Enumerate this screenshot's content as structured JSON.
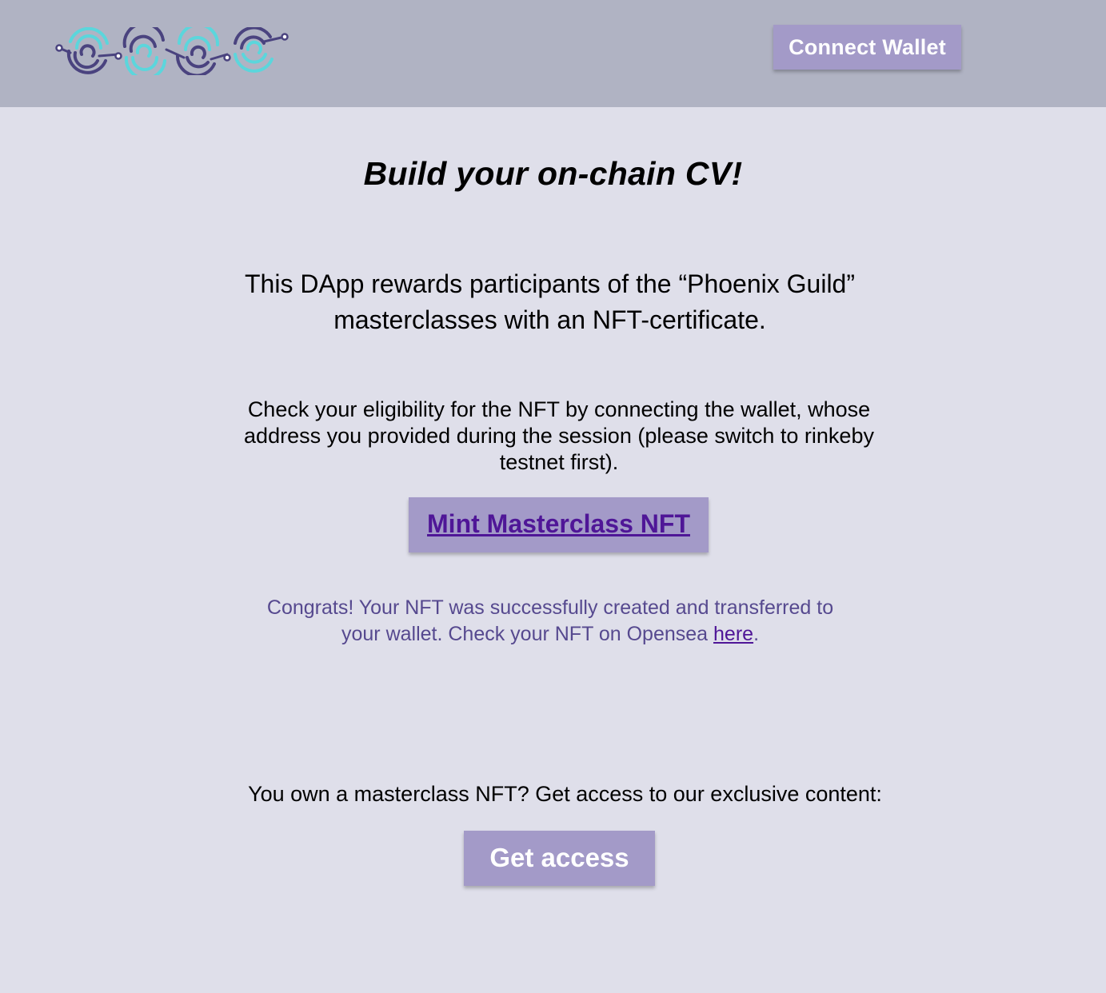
{
  "colors": {
    "header_bg": "#b0b3c3",
    "page_bg": "#dfdfea",
    "button_bg": "#a39ac8",
    "link": "#4f1697",
    "congrats_text": "#56498f",
    "logo_dark": "#4a437f",
    "logo_light": "#5bd6dc"
  },
  "header": {
    "logo_icon": "phoenix-guild-chain-logo",
    "connect_label": "Connect Wallet"
  },
  "main": {
    "title": "Build your on-chain CV!",
    "intro": "This DApp rewards participants of the “Phoenix Guild” masterclasses with an NFT-certificate.",
    "eligibility": "Check your eligibility for the NFT by connecting the wallet, whose address you provided during the session (please switch to rinkeby testnet first).",
    "mint_label": "Mint Masterclass NFT",
    "congrats_text": "Congrats! Your NFT was successfully created and transferred to your wallet. Check your NFT on Opensea ",
    "congrats_link": "here",
    "congrats_end": ".",
    "own_text": "You own a masterclass NFT? Get access to our exclusive content:",
    "access_label": "Get access"
  }
}
